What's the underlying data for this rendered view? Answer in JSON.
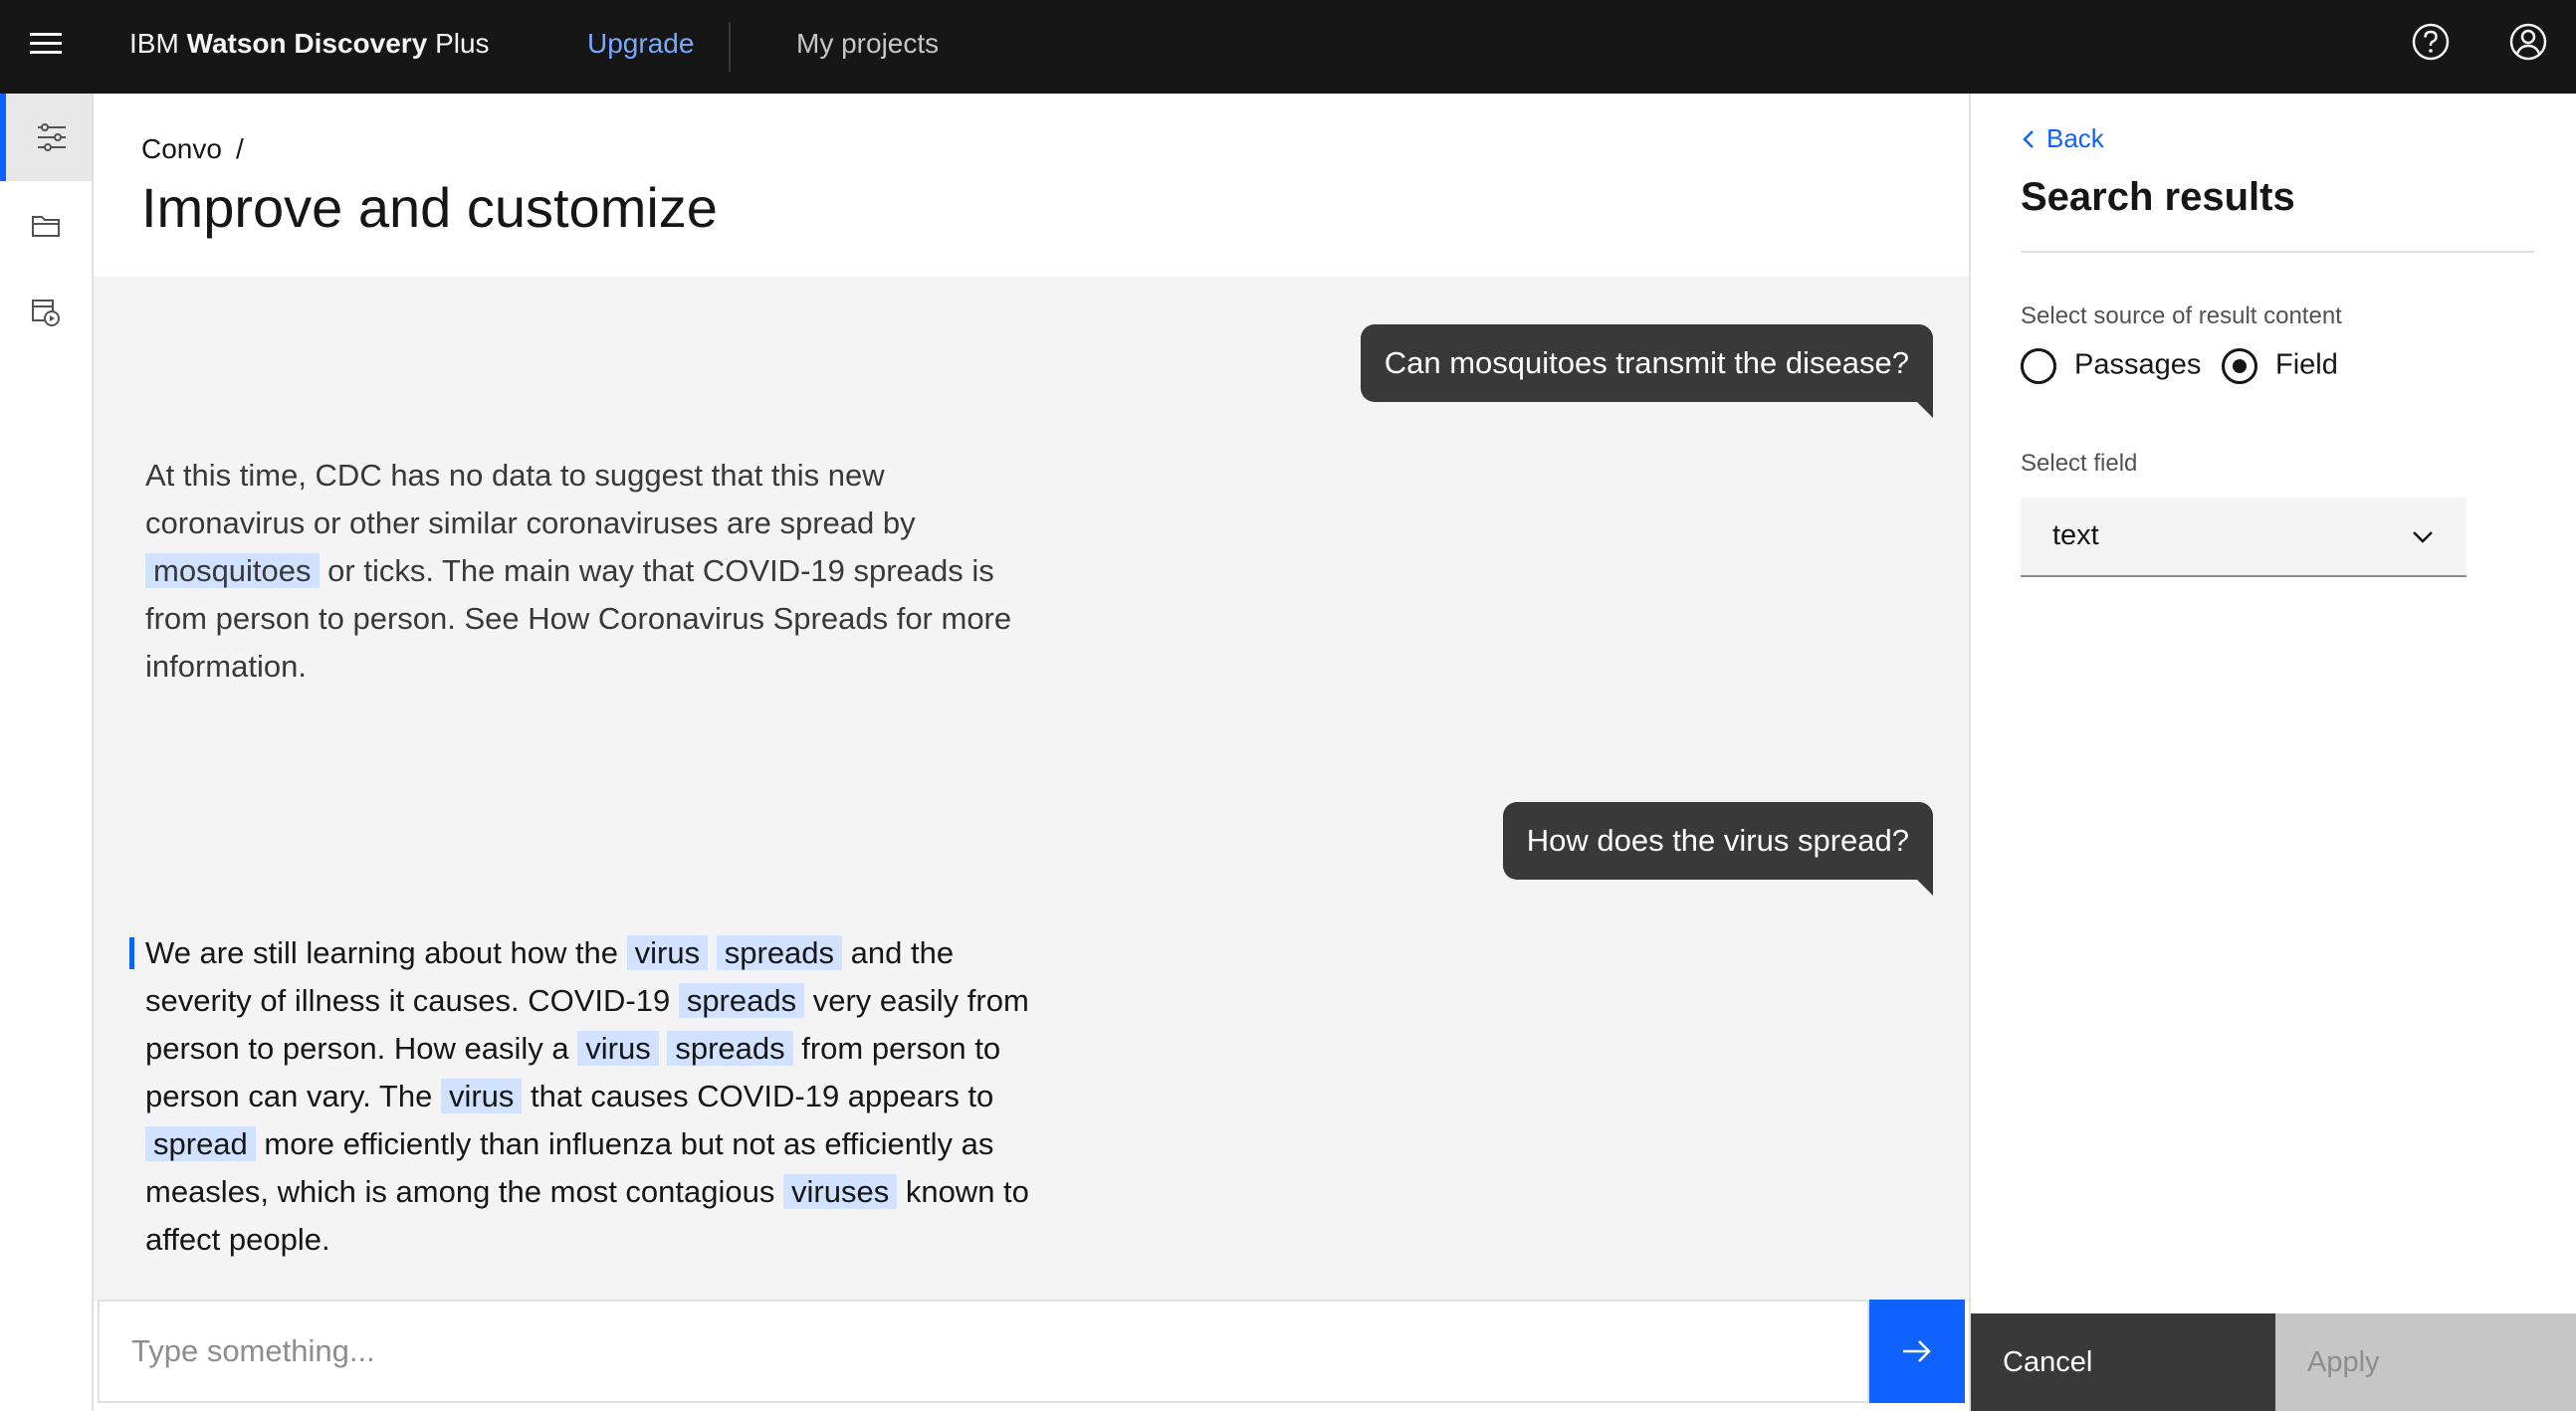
{
  "header": {
    "brand_prefix": "IBM",
    "brand_bold": "Watson Discovery",
    "brand_suffix": "Plus",
    "upgrade_label": "Upgrade",
    "projects_label": "My projects",
    "icons": [
      "menu-icon",
      "help-icon",
      "user-avatar-icon"
    ]
  },
  "rail": {
    "items": [
      {
        "icon": "settings-adjust-icon",
        "active": true
      },
      {
        "icon": "folder-icon",
        "active": false
      },
      {
        "icon": "data-base-add-icon",
        "active": false
      }
    ]
  },
  "page": {
    "breadcrumb": "Convo",
    "breadcrumb_separator": "/",
    "title": "Improve and customize"
  },
  "conversation": {
    "messages": [
      {
        "role": "user",
        "text": "Can mosquitoes transmit the disease?"
      },
      {
        "role": "bot",
        "segments": [
          {
            "text": "At this time, CDC has no data to suggest that this new coronavirus or other similar coronaviruses are spread by",
            "hl": false
          },
          {
            "text": "mosquitoes",
            "hl": true
          },
          {
            "text": "or ticks. The main way that COVID-19 spreads is from person to person. See How Coronavirus Spreads for more information.",
            "hl": false
          }
        ]
      },
      {
        "role": "user",
        "text": "How does the virus spread?"
      },
      {
        "role": "bot",
        "segments": [
          {
            "text": "We are still learning about how the",
            "hl": false
          },
          {
            "text": "virus",
            "hl": true
          },
          {
            "text": "spreads",
            "hl": true
          },
          {
            "text": "and the severity of illness it causes. COVID-19",
            "hl": false
          },
          {
            "text": "spreads",
            "hl": true
          },
          {
            "text": "very easily from person to person. How easily a",
            "hl": false
          },
          {
            "text": "virus",
            "hl": true
          },
          {
            "text": "spreads",
            "hl": true
          },
          {
            "text": "from person to person can vary. The",
            "hl": false
          },
          {
            "text": "virus",
            "hl": true
          },
          {
            "text": "that causes COVID-19 appears to",
            "hl": false
          },
          {
            "text": "spread",
            "hl": true
          },
          {
            "text": "more efficiently than influenza but not as efficiently as measles, which is among the most contagious",
            "hl": false
          },
          {
            "text": "viruses",
            "hl": true
          },
          {
            "text": "known to affect people.",
            "hl": false
          }
        ]
      }
    ],
    "input_placeholder": "Type something...",
    "input_value": ""
  },
  "panel": {
    "back_label": "Back",
    "title": "Search results",
    "source_label": "Select source of result content",
    "radio_options": [
      {
        "label": "Passages",
        "checked": false
      },
      {
        "label": "Field",
        "checked": true
      }
    ],
    "field_label": "Select field",
    "field_value": "text",
    "cancel_label": "Cancel",
    "apply_label": "Apply"
  },
  "colors": {
    "header_bg": "#161616",
    "accent": "#0f62fe",
    "link_light": "#78a9ff",
    "highlight": "#d0e2ff",
    "bubble": "#393939",
    "canvas": "#f4f4f4"
  }
}
